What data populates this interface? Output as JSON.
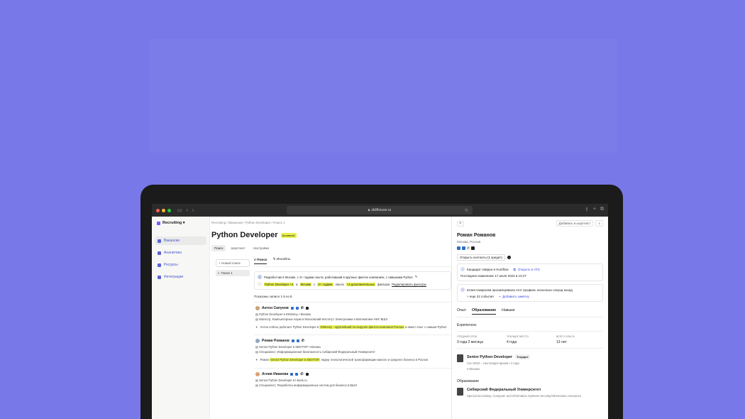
{
  "browser": {
    "url": "skillhouse.ru"
  },
  "sidebar": {
    "brand": "Recruiting ▾",
    "items": [
      {
        "label": "Вакансии"
      },
      {
        "label": "Аналитика"
      },
      {
        "label": "Ресурсы"
      },
      {
        "label": "Интеграции"
      }
    ]
  },
  "main": {
    "breadcrumb": "Recruiting / Вакансии / Python Developer / Поиск 1",
    "title": "Python Developer",
    "badge": "Активный",
    "tabs": [
      "Поиск",
      "Шортлист",
      "Настройки"
    ],
    "new_search": "+ Новый поиск",
    "search_item": "Поиск 1",
    "content_tabs": [
      "Поиск",
      "Инсайты"
    ],
    "query": "Разработчик в Москве, с 3+ годами опыта, работавший в крупных финтех компаниях, с навыками Python",
    "filters": {
      "f1": "Python Developer +4",
      "w1": "в",
      "f2": "Москве",
      "w2": "с",
      "f3": "3+ годами",
      "w3": "опыта",
      "f4": "+2 дополнительных",
      "w4": "фильтра",
      "edit": "Редактировать фильтры"
    },
    "shown": "Показаны записи 1-5 из 8.",
    "candidates": [
      {
        "name": "Антон Сапунов",
        "role": "Python Developer в ЮMoney",
        "loc": "• Москва",
        "edu": "Магистр, Компьютерные науки в Московский Институт Электроники и Математики НИУ ВШЭ",
        "summary_pre": "Антон сейчас работает Python Developer в",
        "summary_hl": "ЮMoney - крупнейший по выручке финтех-компания России",
        "summary_post": "и имеет опыт с навыки Python"
      },
      {
        "name": "Роман Романов",
        "role": "Senior Python Developer в SBOTOP",
        "loc": "• Москва",
        "edu": "Специалист, Информационная безопасность Сибирский Федеральный Университет",
        "summary_pre": "Роман",
        "summary_hl": "Senior Python Developer в SBOTOP,",
        "summary_post": "лидер технологической трансформации малого и среднего бизнеса в России"
      },
      {
        "name": "Агния Иванова",
        "role": "Senior Python Developer в t-bank.ru",
        "loc": "",
        "edu": "Специалист, Разработка информационных систем для бизнеса в ВШЭ"
      }
    ]
  },
  "panel": {
    "shortlist": "Добавить в шортлист",
    "name": "Роман Романов",
    "location": "Москва, Россия",
    "open_contacts": "Открыть контакты (1 кредит)",
    "found": "Кандидат найден в Huntflow",
    "open_ats": "Открыть в ATS",
    "last_change": "Последнее изменение 17 июля 2024 в 13:47",
    "viewed": "Юлия Смирнова просматривала этот профиль несколько секунд назад",
    "more_events": "+ еще 22 события",
    "add_note": "Добавить заметку",
    "tabs": [
      "Опыт",
      "Образование",
      "Навыки"
    ],
    "experiences_title": "Experiences",
    "stats": [
      {
        "label": "СРЕДНИЙ СРОК",
        "value": "3 года 2 месяца"
      },
      {
        "label": "ТЕКУЩЕЕ МЕСТО",
        "value": "4 года"
      },
      {
        "label": "ВСЕГО ОПЫТА",
        "value": "13 лет"
      }
    ],
    "job": {
      "title": "Senior Python Developer",
      "tag": "Текущее",
      "period": "Сен 2020 – Настоящее время • 4 года",
      "location": "Москва"
    },
    "education_title": "Образование",
    "edu": {
      "title": "Сибирский Федеральный Университет",
      "meta": "Special secondary, Computer and Information Systems Security/Information Assurance"
    }
  }
}
